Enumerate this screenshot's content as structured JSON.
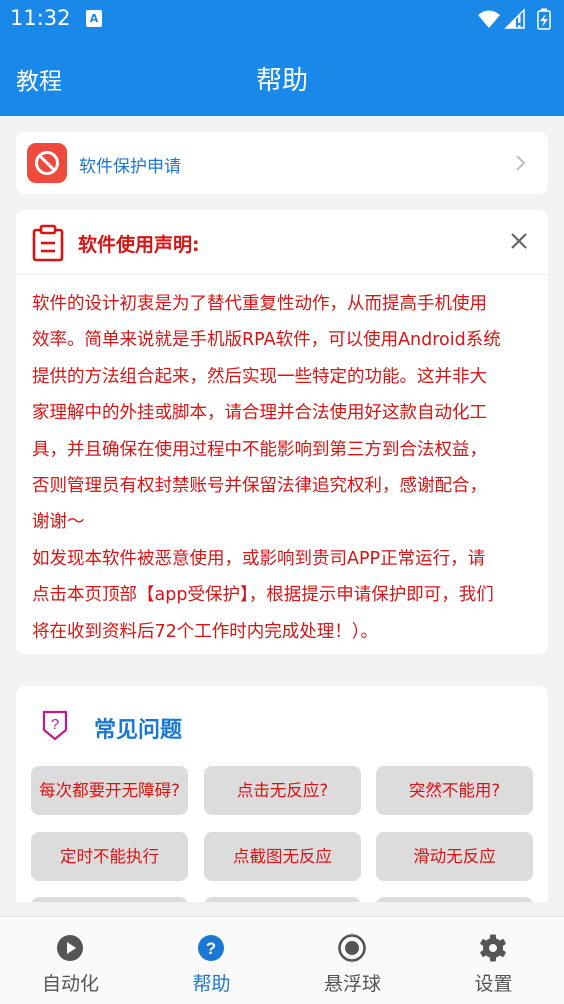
{
  "status_bar": {
    "time": "11:32",
    "notification_icon": "A"
  },
  "header": {
    "left_label": "教程",
    "title": "帮助"
  },
  "protect_entry": {
    "label": "软件保护申请",
    "icon": "prohibit-icon"
  },
  "notice": {
    "title": "软件使用声明:",
    "lines": [
      "软件的设计初衷是为了替代重复性动作，从而提高手机使用",
      "效率。简单来说就是手机版RPA软件，可以使用Android系统",
      "提供的方法组合起来，然后实现一些特定的功能。这并非大",
      "家理解中的外挂或脚本，请合理并合法使用好这款自动化工",
      "具，并且确保在使用过程中不能影响到第三方到合法权益，",
      "否则管理员有权封禁账号并保留法律追究权利，感谢配合，",
      "谢谢～",
      "如发现本软件被恶意使用，或影响到贵司APP正常运行，请",
      "点击本页顶部【app受保护】，根据提示申请保护即可，我们",
      "将在收到资料后72个工作时内完成处理！）。"
    ]
  },
  "faq": {
    "title": "常见问题",
    "buttons": [
      "每次都要开无障碍?",
      "点击无反应?",
      "突然不能用?",
      "定时不能执行",
      "点截图无反应",
      "滑动无反应"
    ]
  },
  "tabs": [
    {
      "label": "自动化",
      "icon": "play-circle-icon"
    },
    {
      "label": "帮助",
      "icon": "help-circle-icon",
      "active": true
    },
    {
      "label": "悬浮球",
      "icon": "radio-button-icon"
    },
    {
      "label": "设置",
      "icon": "gear-icon"
    }
  ],
  "colors": {
    "primary": "#1a88e8",
    "danger_text": "#d81414",
    "link_text": "#1a78d4"
  }
}
